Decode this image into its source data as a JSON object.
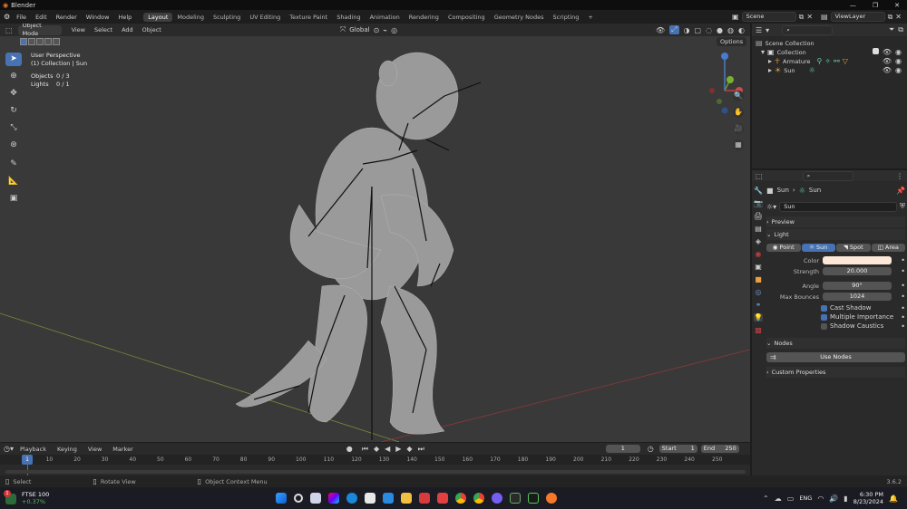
{
  "titlebar": {
    "title": "Blender"
  },
  "menus": [
    "File",
    "Edit",
    "Render",
    "Window",
    "Help"
  ],
  "workspaces": [
    "Layout",
    "Modeling",
    "Sculpting",
    "UV Editing",
    "Texture Paint",
    "Shading",
    "Animation",
    "Rendering",
    "Compositing",
    "Geometry Nodes",
    "Scripting"
  ],
  "scene": {
    "name": "Scene",
    "view_layer": "ViewLayer"
  },
  "viewport": {
    "mode": "Object Mode",
    "menus": [
      "View",
      "Select",
      "Add",
      "Object"
    ],
    "transform": "Global",
    "options": "Options",
    "info": {
      "perspective": "User Perspective",
      "collection": "(1) Collection | Sun",
      "objects_label": "Objects",
      "objects_value": "0 / 3",
      "lights_label": "Lights",
      "lights_value": "0 / 1"
    },
    "gizmo": {
      "x": "X",
      "y": "Y",
      "z": "Z"
    }
  },
  "outliner": {
    "items": [
      {
        "label": "Scene Collection"
      },
      {
        "label": "Collection"
      },
      {
        "label": "Armature"
      },
      {
        "label": "Sun"
      }
    ]
  },
  "properties": {
    "breadcrumb": [
      "Sun",
      "Sun"
    ],
    "datablock": "Sun",
    "panels": {
      "preview": "Preview",
      "light": "Light",
      "nodes": "Nodes",
      "custom": "Custom Properties"
    },
    "light_types": [
      "Point",
      "Sun",
      "Spot",
      "Area"
    ],
    "fields": [
      {
        "label": "Color",
        "value": ""
      },
      {
        "label": "Strength",
        "value": "20.000"
      },
      {
        "label": "Angle",
        "value": "90°"
      },
      {
        "label": "Max Bounces",
        "value": "1024"
      }
    ],
    "checks": [
      {
        "label": "Cast Shadow",
        "on": true
      },
      {
        "label": "Multiple Importance",
        "on": true
      },
      {
        "label": "Shadow Caustics",
        "on": false
      }
    ],
    "use_nodes": "Use Nodes"
  },
  "timeline": {
    "menus": [
      "Playback",
      "Keying",
      "View",
      "Marker"
    ],
    "current_frame": "1",
    "start_label": "Start",
    "start": "1",
    "end_label": "End",
    "end": "250",
    "ticks": [
      "10",
      "20",
      "30",
      "40",
      "50",
      "60",
      "70",
      "80",
      "90",
      "100",
      "110",
      "120",
      "130",
      "140",
      "150",
      "160",
      "170",
      "180",
      "190",
      "200",
      "210",
      "220",
      "230",
      "240",
      "250"
    ],
    "playhead": "1"
  },
  "statusbar": {
    "select": "Select",
    "rotate": "Rotate View",
    "context": "Object Context Menu",
    "version": "3.6.2"
  },
  "taskbar": {
    "stock_name": "FTSE 100",
    "stock_change": "+0.37%",
    "badge": "1",
    "lang": "ENG",
    "time": "6:30 PM",
    "date": "8/23/2024"
  }
}
